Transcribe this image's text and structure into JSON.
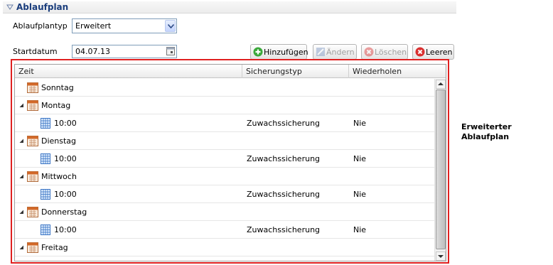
{
  "section": {
    "title": "Ablaufplan"
  },
  "form": {
    "type_label": "Ablaufplantyp",
    "type_value": "Erweitert",
    "start_label": "Startdatum",
    "start_value": "04.07.13"
  },
  "toolbar": {
    "add_label": "Hinzufügen",
    "edit_label": "Ändern",
    "delete_label": "Löschen",
    "clear_label": "Leeren"
  },
  "grid": {
    "headers": [
      "Zeit",
      "Sicherungstyp",
      "Wiederholen"
    ],
    "rows": [
      {
        "level": 0,
        "expander": false,
        "label": "Sonntag",
        "type": "",
        "repeat": ""
      },
      {
        "level": 0,
        "expander": true,
        "label": "Montag",
        "type": "",
        "repeat": ""
      },
      {
        "level": 1,
        "expander": false,
        "label": "10:00",
        "type": "Zuwachssicherung",
        "repeat": "Nie"
      },
      {
        "level": 0,
        "expander": true,
        "label": "Dienstag",
        "type": "",
        "repeat": ""
      },
      {
        "level": 1,
        "expander": false,
        "label": "10:00",
        "type": "Zuwachssicherung",
        "repeat": "Nie"
      },
      {
        "level": 0,
        "expander": true,
        "label": "Mittwoch",
        "type": "",
        "repeat": ""
      },
      {
        "level": 1,
        "expander": false,
        "label": "10:00",
        "type": "Zuwachssicherung",
        "repeat": "Nie"
      },
      {
        "level": 0,
        "expander": true,
        "label": "Donnerstag",
        "type": "",
        "repeat": ""
      },
      {
        "level": 1,
        "expander": false,
        "label": "10:00",
        "type": "Zuwachssicherung",
        "repeat": "Nie"
      },
      {
        "level": 0,
        "expander": true,
        "label": "Freitag",
        "type": "",
        "repeat": ""
      }
    ]
  },
  "annotation": {
    "line1": "Erweiterter",
    "line2": "Ablaufplan"
  },
  "colors": {
    "highlight": "#e02020",
    "header_text": "#1a3d7c",
    "add_icon": "#3aa83a",
    "delete_icon": "#d93030"
  }
}
